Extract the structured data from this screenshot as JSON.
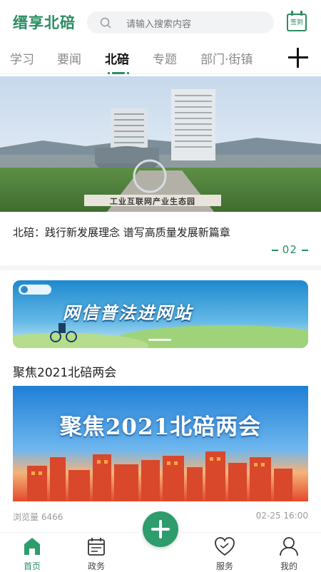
{
  "app": {
    "logo_text": "缙享北碚",
    "brand_color": "#2a8d62"
  },
  "search": {
    "placeholder": "请输入搜索内容"
  },
  "signin": {
    "label": "签到"
  },
  "tabs": [
    {
      "label": "学习",
      "active": false
    },
    {
      "label": "要闻",
      "active": false
    },
    {
      "label": "北碚",
      "active": true
    },
    {
      "label": "专题",
      "active": false
    },
    {
      "label": "部门·街镇",
      "active": false
    }
  ],
  "hero": {
    "sign_text": "工业互联网产业生态园",
    "caption": "北碚：践行新发展理念 谱写高质量发展新篇章",
    "page": "02"
  },
  "banner": {
    "text": "网信普法进网站"
  },
  "section": {
    "title": "聚焦2021北碚两会",
    "poster_text": "聚焦2021北碚两会",
    "views_label": "浏览量 6466",
    "date": "02-25 16:00"
  },
  "bottom_nav": [
    {
      "label": "首页",
      "icon": "home-icon",
      "active": true
    },
    {
      "label": "政务",
      "icon": "calendar-icon",
      "active": false
    },
    {
      "label": "服务",
      "icon": "heart-icon",
      "active": false
    },
    {
      "label": "我的",
      "icon": "user-icon",
      "active": false
    }
  ]
}
